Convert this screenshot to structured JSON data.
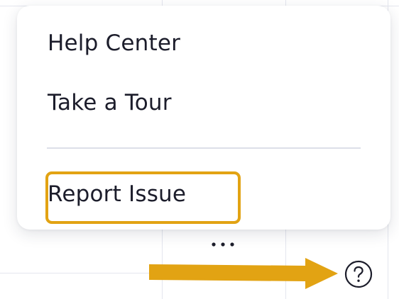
{
  "menu": {
    "items": [
      {
        "label": "Help Center"
      },
      {
        "label": "Take a Tour"
      }
    ],
    "report_issue_label": "Report Issue"
  },
  "icons": {
    "more": "more-horizontal-icon",
    "help": "question-circle-icon"
  },
  "colors": {
    "highlight": "#e2a313",
    "arrow": "#e2a313",
    "text": "#1c1d2b"
  }
}
